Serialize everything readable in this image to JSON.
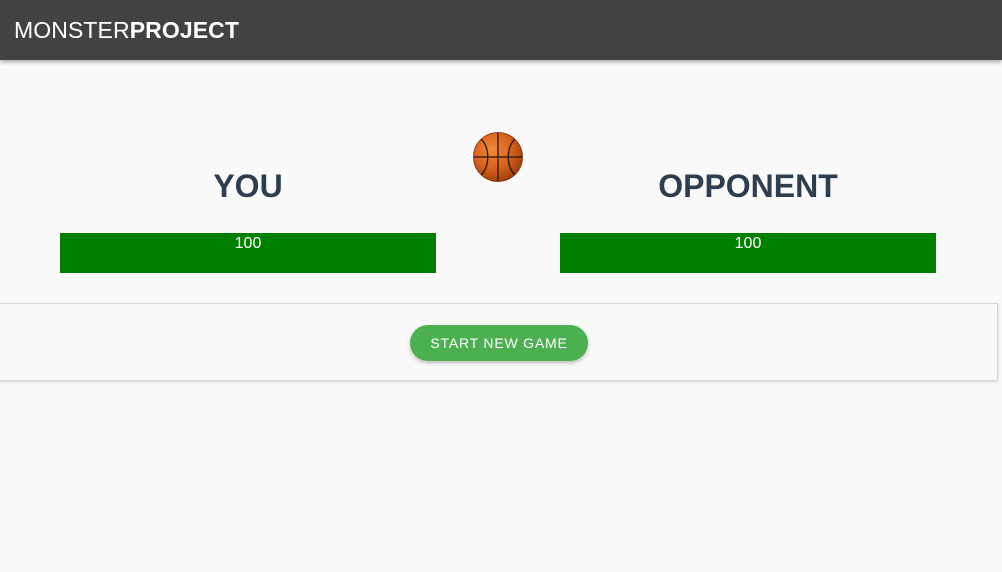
{
  "app_bar": {
    "brand_light": "MONSTER",
    "brand_bold": "PROJECT"
  },
  "players": {
    "you": {
      "name": "YOU",
      "health": 100,
      "health_max": 100
    },
    "opponent": {
      "name": "OPPONENT",
      "health": 100,
      "health_max": 100
    }
  },
  "ball_icon": "basketball-icon",
  "controls": {
    "start_label": "START NEW GAME"
  },
  "colors": {
    "app_bar": "#424242",
    "player_name": "#2c3e50",
    "health_fill": "#008000",
    "start_button": "#4caf50",
    "background": "#fafafa"
  }
}
